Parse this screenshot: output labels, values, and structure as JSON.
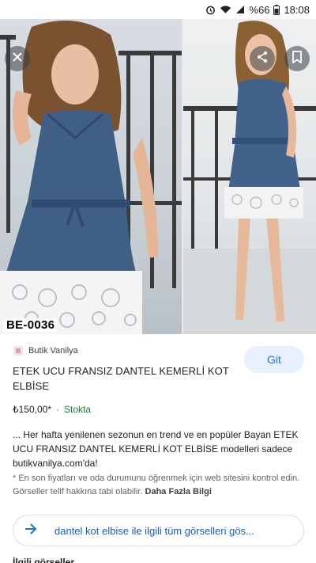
{
  "status_bar": {
    "battery": "%66",
    "time": "18:08"
  },
  "image": {
    "code_label": "BE-0036"
  },
  "source": {
    "name": "Butik Vanilya"
  },
  "visit_button": {
    "label": "Git"
  },
  "product": {
    "title": "ETEK UCU FRANSIZ DANTEL KEMERLİ KOT ELBİSE",
    "price": "₺150,00*",
    "separator": "·",
    "stock": "Stokta"
  },
  "description": {
    "text": "... Her hafta yenilenen sezonun en trend ve en popüler Bayan ETEK UCU FRANSIZ DANTEL KEMERLİ KOT ELBİSE modelleri sadece butikvanilya.com'da!"
  },
  "disclaimer": {
    "text": "* En son fiyatları ve oda durumunu öğrenmek için web sitesini kontrol edin. Görseller telif hakkına tabi olabilir.",
    "more_link": "Daha Fazla Bilgi"
  },
  "related": {
    "label": "dantel kot elbise ile ilgili tüm görselleri gös..."
  },
  "bottom": {
    "partial_heading": "İlgili görseller"
  },
  "icons": [
    "alarm-icon",
    "wifi-icon",
    "signal-icon",
    "close-icon",
    "share-icon",
    "bookmark-icon",
    "arrow-right-icon",
    "site-favicon"
  ],
  "colors": {
    "accent": "#1a73e8",
    "visit_bg": "#e8f0fe",
    "stock_green": "#188038",
    "denim": "#3f5f86"
  }
}
